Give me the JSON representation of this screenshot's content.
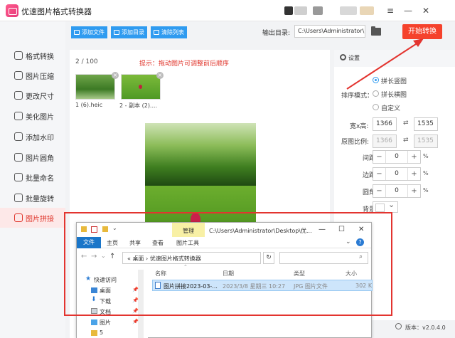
{
  "app": {
    "title": "优速图片格式转换器",
    "version": "版本：v2.0.4.0"
  },
  "window_controls": {
    "menu": "≡",
    "minimize": "—",
    "close": "✕"
  },
  "sidebar": {
    "items": [
      {
        "label": "格式转换",
        "active": false
      },
      {
        "label": "图片压缩",
        "active": false
      },
      {
        "label": "更改尺寸",
        "active": false
      },
      {
        "label": "美化图片",
        "active": false
      },
      {
        "label": "添加水印",
        "active": false
      },
      {
        "label": "图片圆角",
        "active": false
      },
      {
        "label": "批量命名",
        "active": false
      },
      {
        "label": "批量旋转",
        "active": false
      },
      {
        "label": "图片拼接",
        "active": true
      }
    ]
  },
  "toolbar": {
    "add_file": "添加文件",
    "add_folder": "添加目录",
    "clear_list": "清除列表",
    "output_label": "输出目录:",
    "output_path": "C:\\Users\\Administrator\\",
    "start": "开始转换"
  },
  "content": {
    "counter": "2 / 100",
    "hint": "提示：拖动图片可调整前后顺序",
    "thumbnails": [
      {
        "name": "1 (6).heic"
      },
      {
        "name": "2 - 副本 (2)...."
      }
    ]
  },
  "settings": {
    "title": "设置",
    "sort_label": "排序模式：",
    "sort_options": [
      "拼长竖图",
      "拼长横图",
      "自定义"
    ],
    "sort_selected": "拼长竖图",
    "size_label": "宽x高:",
    "width": "1366",
    "height": "1535",
    "ratio_label": "原图比例:",
    "ratio_w": "1366",
    "ratio_h": "1535",
    "spacing_label": "间距:",
    "spacing": "0",
    "border_label": "边距:",
    "border": "0",
    "radius_label": "圆角:",
    "radius": "0",
    "pct": "%",
    "bg_label": "背景:"
  },
  "explorer": {
    "manage": "管理",
    "path_title": "C:\\Users\\Administrator\\Desktop\\优...",
    "tabs": [
      "文件",
      "主页",
      "共享",
      "查看",
      "图片工具"
    ],
    "address": "« 桌面 › 优速图片格式转换器",
    "nav_items": [
      "快速访问",
      "桌面",
      "下载",
      "文档",
      "图片",
      "5"
    ],
    "columns": [
      "名称",
      "日期",
      "类型",
      "大小"
    ],
    "file": {
      "name": "图片拼接2023-03-...",
      "date": "2023/3/8 星期三 10:27",
      "type": "JPG 图片文件",
      "size": "302 K"
    }
  },
  "colors": {
    "accent": "#2f9bf0",
    "start": "#f5422c",
    "highlight": "#e3342f",
    "active_bg": "#fde8e8"
  }
}
